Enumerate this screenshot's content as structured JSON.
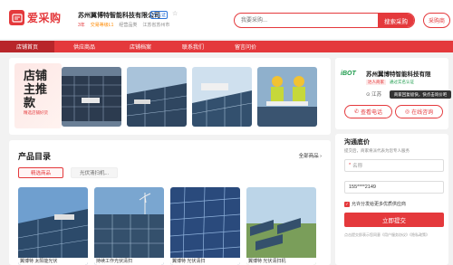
{
  "header": {
    "logo_text": "爱采购",
    "company_name": "苏州翼博特智能科技有限公司",
    "verified_badge": "已认证",
    "star_icon": "star-outline-icon",
    "meta": {
      "years": "3年",
      "level": "交易等级L1",
      "products": "经营品类",
      "location": "江苏省苏州市"
    },
    "search_placeholder": "我要采购...",
    "search_button": "搜索采购",
    "purchase_button": "采购商"
  },
  "nav": {
    "items": [
      "店铺首页",
      "供应商品",
      "店铺档案",
      "联系我们",
      "留言问价"
    ],
    "active_index": 0
  },
  "banner": {
    "title": "店铺主推款",
    "subtitle": "精选店铺好货"
  },
  "catalog": {
    "title": "产品目录",
    "all_link": "全部商品 ›",
    "tabs": [
      "精选商品",
      "光伏清扫机..."
    ],
    "products": [
      {
        "caption": "翼博特 太阳能光伏"
      },
      {
        "caption": "持续工作光伏清扫"
      },
      {
        "caption": "翼博特 光伏清扫"
      },
      {
        "caption": "翼博特 光伏清扫机"
      }
    ]
  },
  "right_card": {
    "logo": "iBOT",
    "company_name": "苏州翼博特智能科技有限",
    "badge_member": "达人商家",
    "badge_cert": "通过实名认证",
    "location": "江苏",
    "tooltip": "商家回复极快，快点击询价吧",
    "phone_button": "查看电话",
    "consult_button": "在线咨询"
  },
  "inquiry": {
    "title": "沟通底价",
    "subtitle": "提交后，商家将派代表为您专人服务",
    "name_placeholder": "名称",
    "phone_placeholder": "手机号",
    "phone_value": "155****2149",
    "checkbox_label": "允许分发给更多优质供应商",
    "submit_button": "立即提交",
    "agreement": "点击提交即表示您同意《用户服务协议》《隐私政策》"
  },
  "colors": {
    "brand_red": "#e4393c",
    "nav_active": "#b8262a"
  }
}
